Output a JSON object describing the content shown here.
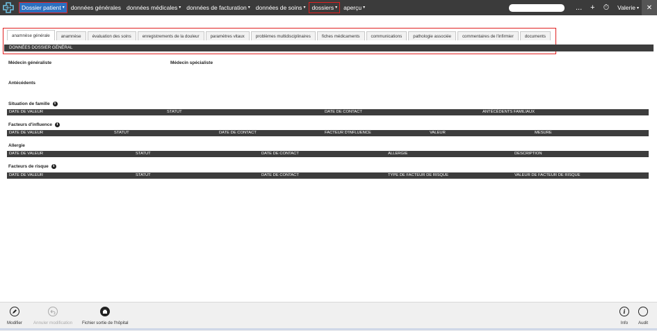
{
  "topbar": {
    "nav": [
      {
        "label": "Dossier patient",
        "caret": "▾"
      },
      {
        "label": "données générales",
        "caret": ""
      },
      {
        "label": "données médicales",
        "caret": "▾"
      },
      {
        "label": "données de facturation",
        "caret": "▾"
      },
      {
        "label": "données de soins",
        "caret": "▾"
      },
      {
        "label": "dossiers",
        "caret": "▾"
      },
      {
        "label": "aperçu",
        "caret": "▾"
      }
    ],
    "tools": {
      "more": "...",
      "add": "+",
      "timer": "⏱"
    },
    "user": {
      "name": "Valerie",
      "caret": "▾"
    },
    "close": "✕"
  },
  "tabs": [
    "anamnèse générale",
    "anamnèse",
    "évaluation des soins",
    "enregistrements de la douleur",
    "paramètres vitaux",
    "problèmes multidisciplinaires",
    "fiches médicaments",
    "communications",
    "pathologie associée",
    "commentaires de l'infirmier",
    "documents"
  ],
  "section_title": "DONNÉES DOSSIER GÉNÉRAL",
  "fields": {
    "gp": "Médecin généraliste",
    "specialist": "Médecin spécialiste",
    "antecedents": "Antécédents"
  },
  "tables": {
    "family": {
      "title": "Situation de famille",
      "columns": [
        "DATE DE VALEUR",
        "STATUT",
        "DATE DE CONTACT",
        "ANTÉCÉDENTS FAMILIAUX"
      ]
    },
    "influence": {
      "title": "Facteurs d'influence",
      "columns": [
        "DATE DE VALEUR",
        "STATUT",
        "DATE DE CONTACT",
        "FACTEUR D'INFLUENCE",
        "VALEUR",
        "MESURE"
      ]
    },
    "allergy": {
      "title": "Allergie",
      "columns": [
        "DATE DE VALEUR",
        "STATUT",
        "DATE DE CONTACT",
        "ALLERGIE",
        "DESCRIPTION"
      ]
    },
    "risk": {
      "title": "Facteurs de risque",
      "columns": [
        "DATE DE VALEUR",
        "STATUT",
        "DATE DE CONTACT",
        "TYPE DE FACTEUR DE RISQUE",
        "VALEUR DE FACTEUR DE RISQUE"
      ]
    }
  },
  "info_glyph": "i",
  "bottom": {
    "modify": "Modifier",
    "cancel": "Annuler modification",
    "discharge": "Fichier sortie de l'hôpital",
    "info": "Info",
    "audit": "Audit"
  },
  "colors": {
    "topbar": "#3b3b3b",
    "active_nav": "#2c6fbf",
    "highlight": "#e02020",
    "table_header": "#3d3d3d"
  }
}
